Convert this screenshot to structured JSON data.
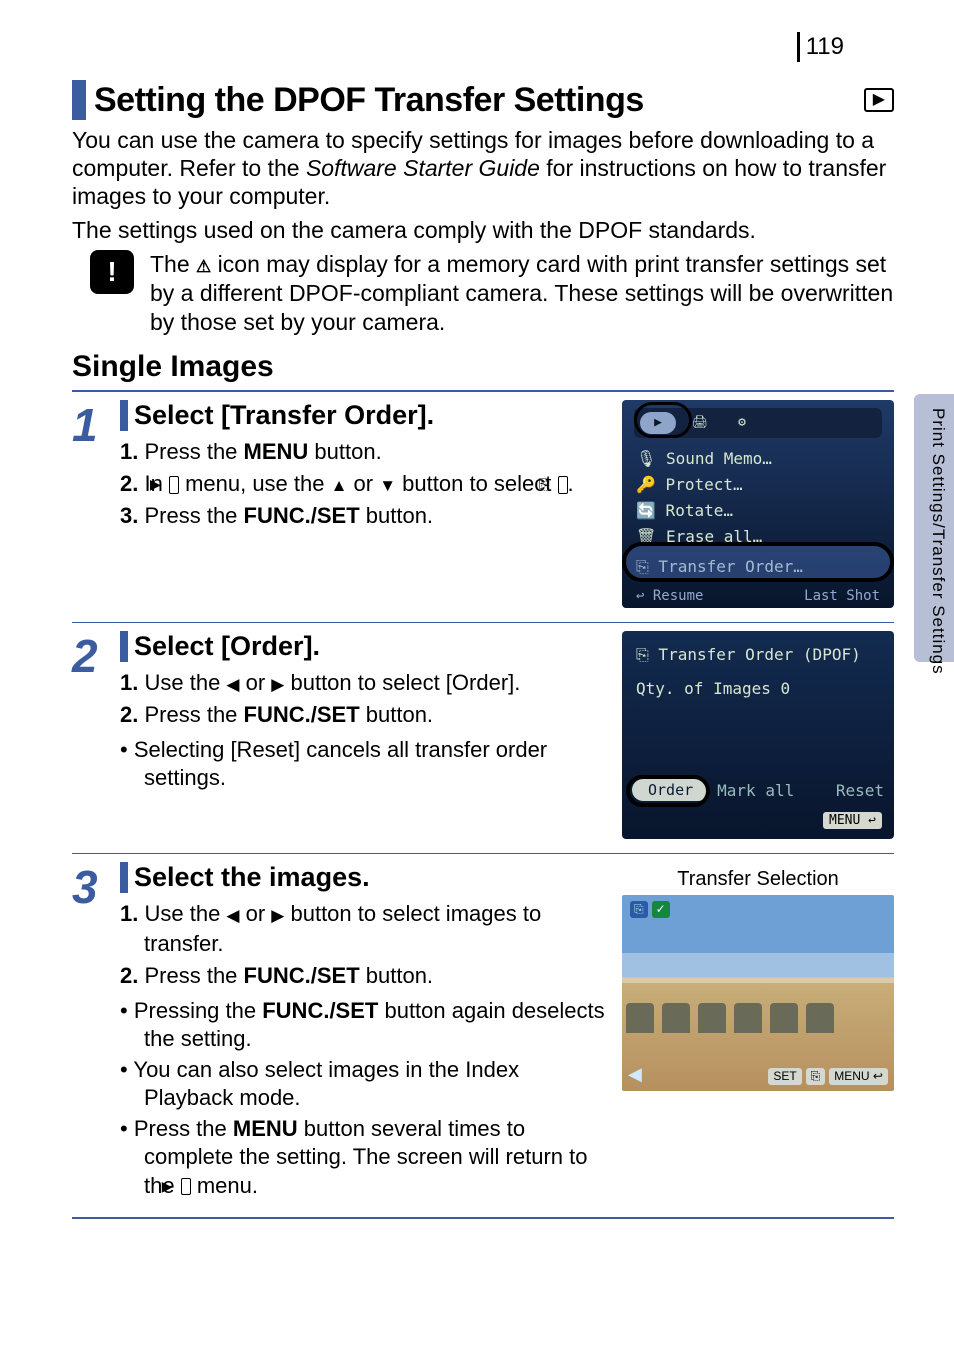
{
  "page_number": "119",
  "side_tab": "Print Settings/Transfer Settings",
  "heading": "Setting the DPOF Transfer Settings",
  "intro": {
    "p1a": "You can use the camera to specify settings for images before downloading to a computer. Refer to the ",
    "p1b": "Software Starter Guide",
    "p1c": " for instructions on how to transfer images to your computer.",
    "p2": "The settings used on the camera comply with the DPOF standards."
  },
  "warning": {
    "t1": "The ",
    "icon": "⚠",
    "t2": " icon may display for a memory card with print transfer settings set by a different DPOF-compliant camera. These settings will be overwritten by those set by your camera."
  },
  "subheading": "Single Images",
  "steps": [
    {
      "num": "1",
      "title": "Select [Transfer Order].",
      "lines": [
        {
          "n": "1.",
          "a": "Press the ",
          "b": "MENU",
          "c": " button."
        },
        {
          "n": "2.",
          "a": "In ",
          "icon": "▶",
          "b2": " menu, use the ",
          "up": "▲",
          "c2": " or ",
          "down": "▼",
          "d": " button to select ",
          "icon2": "⎘",
          "e": "."
        },
        {
          "n": "3.",
          "a": "Press the ",
          "b": "FUNC./SET",
          "c": " button."
        }
      ]
    },
    {
      "num": "2",
      "title": "Select [Order].",
      "lines": [
        {
          "n": "1.",
          "a": "Use the ",
          "l": "◀",
          "b2": " or ",
          "r": "▶",
          "c": " button to select [Order]."
        },
        {
          "n": "2.",
          "a": "Press the ",
          "b": "FUNC./SET",
          "c": " button."
        }
      ],
      "bullets": [
        "Selecting [Reset] cancels all transfer order settings."
      ]
    },
    {
      "num": "3",
      "title": "Select the images.",
      "lines": [
        {
          "n": "1.",
          "a": "Use the ",
          "l": "◀",
          "b2": " or ",
          "r": "▶",
          "c": " button to select images to transfer."
        },
        {
          "n": "2.",
          "a": "Press the ",
          "b": "FUNC./SET",
          "c": " button."
        }
      ],
      "bullets": [
        "Pressing the <b>FUNC./SET</b> button again deselects the setting.",
        "You can also select images in the Index Playback mode.",
        "Press the <b>MENU</b> button several times to complete the setting. The screen will return to the <span class='inline-icon'>▶</span> menu."
      ]
    }
  ],
  "lcd1": {
    "tab1": "▶",
    "tab2": "🖨",
    "tab3": "⚙",
    "items": [
      "🎙 Sound Memo…",
      "🔑 Protect…",
      "🔄 Rotate…",
      "🗑 Erase all…",
      "⎘ Transfer Order…"
    ],
    "foot_left": "↩ Resume",
    "foot_right": "Last Shot"
  },
  "lcd2": {
    "title": "⎘ Transfer Order (DPOF)",
    "qty": "Qty. of Images  0",
    "order": "Order",
    "mark": "Mark all",
    "reset": "Reset",
    "menu": "MENU ↩"
  },
  "lcd3": {
    "label": "Transfer Selection",
    "set": "SET",
    "xfer": "⎘",
    "menu": "MENU ↩"
  }
}
